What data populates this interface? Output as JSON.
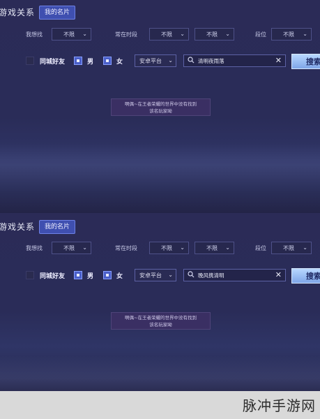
{
  "panels": [
    {
      "title": "游戏关系",
      "card_button": "我的名片",
      "filters": [
        {
          "label": "我想找",
          "value": "不限"
        },
        {
          "label": "常在时段",
          "value": "不限",
          "value2": "不限"
        },
        {
          "label": "段位",
          "value": "不限"
        }
      ],
      "options": {
        "same_city": "同城好友",
        "male": "男",
        "female": "女"
      },
      "platform": "安卓平台",
      "search_value": "清明夜雨落",
      "search_button": "搜索",
      "message_line1": "啊偶~在王者荣耀的世界中没有找到",
      "message_line2": "该名玩家呦"
    },
    {
      "title": "游戏关系",
      "card_button": "我的名片",
      "filters": [
        {
          "label": "我想找",
          "value": "不限"
        },
        {
          "label": "常在时段",
          "value": "不限",
          "value2": "不限"
        },
        {
          "label": "段位",
          "value": "不限"
        }
      ],
      "options": {
        "same_city": "同城好友",
        "male": "男",
        "female": "女"
      },
      "platform": "安卓平台",
      "search_value": "晚风携清明",
      "search_button": "搜索",
      "message_line1": "啊偶~在王者荣耀的世界中没有找到",
      "message_line2": "该名玩家呦"
    }
  ],
  "icons": {
    "chevron": "chevron-down-icon",
    "search": "search-icon",
    "clear": "close-icon"
  },
  "watermark": "脉冲手游网"
}
